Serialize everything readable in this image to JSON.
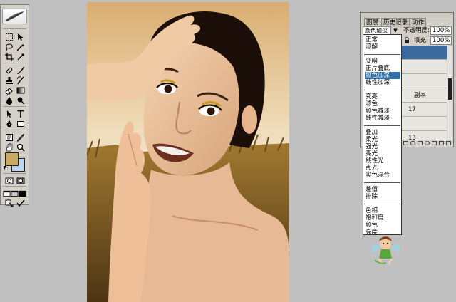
{
  "panel": {
    "tabs": [
      {
        "label": "图层",
        "active": true
      },
      {
        "label": "历史记录",
        "active": false
      },
      {
        "label": "动作",
        "active": false
      }
    ],
    "blend_mode": "颜色加深",
    "opacity_label": "不透明度:",
    "opacity_value": "100%",
    "fill_label": "填充:",
    "fill_value": "100%",
    "layers": [
      {
        "label": "",
        "selected": true
      },
      {
        "label": "",
        "selected": false
      },
      {
        "label": "",
        "selected": false
      },
      {
        "label": "副本",
        "selected": false
      },
      {
        "label": "17",
        "selected": false
      },
      {
        "label": "",
        "selected": false
      },
      {
        "label": "13",
        "selected": false
      }
    ]
  },
  "blend_menu": {
    "groups": [
      [
        "正常",
        "溶解"
      ],
      [
        "变暗",
        "正片叠底",
        "颜色加深",
        "线性加深"
      ],
      [
        "变亮",
        "滤色",
        "颜色减淡",
        "线性减淡"
      ],
      [
        "叠加",
        "柔光",
        "强光",
        "亮光",
        "线性光",
        "点光",
        "实色混合"
      ],
      [
        "差值",
        "排除"
      ],
      [
        "色相",
        "饱和度",
        "颜色",
        "亮度"
      ]
    ],
    "selected": "颜色加深"
  },
  "toolbox": {
    "foreground_color": "#c8aa63",
    "background_color": "#bcd8ef"
  },
  "colors": {
    "app_background": "#c0c0c0",
    "panel_background": "#d4d0c8",
    "selection_blue": "#3d6a9e"
  }
}
